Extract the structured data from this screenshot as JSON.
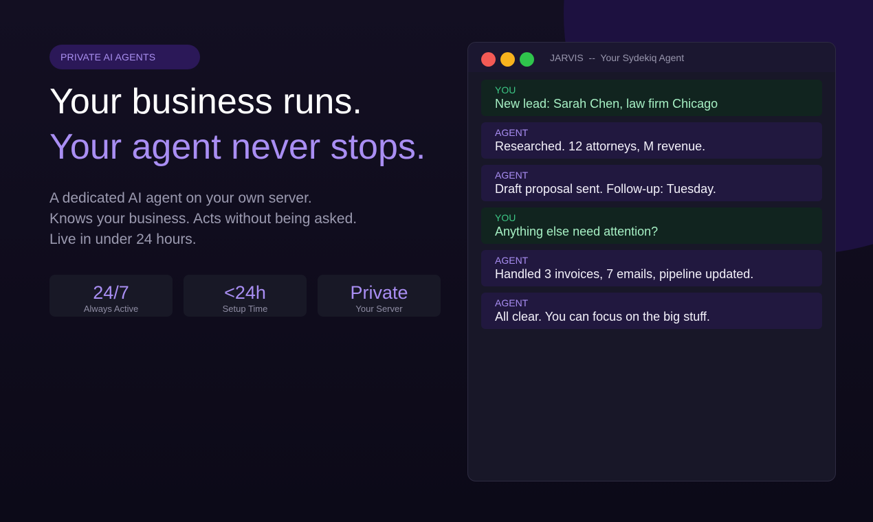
{
  "hero": {
    "badge": "PRIVATE AI AGENTS",
    "headline_line1": "Your business runs.",
    "headline_line2": "Your agent never stops.",
    "description": [
      "A dedicated AI agent on your own server.",
      "Knows your business. Acts without being asked.",
      "Live in under 24 hours."
    ],
    "stats": [
      {
        "value": "24/7",
        "label": "Always Active"
      },
      {
        "value": "<24h",
        "label": "Setup Time"
      },
      {
        "value": "Private",
        "label": "Your Server"
      }
    ]
  },
  "chat_window": {
    "title": "JARVIS  --  Your Sydekiq Agent",
    "messages": [
      {
        "role": "YOU",
        "text": "New lead: Sarah Chen, law firm Chicago"
      },
      {
        "role": "AGENT",
        "text": "Researched. 12 attorneys, M revenue."
      },
      {
        "role": "AGENT",
        "text": "Draft proposal sent. Follow-up: Tuesday."
      },
      {
        "role": "YOU",
        "text": "Anything else need attention?"
      },
      {
        "role": "AGENT",
        "text": "Handled 3 invoices, 7 emails, pipeline updated."
      },
      {
        "role": "AGENT",
        "text": "All clear. You can focus on the big stuff."
      }
    ]
  },
  "colors": {
    "accent": "#a98ef3",
    "background": "#110d1d",
    "you_text": "#a6f0c4",
    "you_role": "#3cc785",
    "close": "#f35a55",
    "minimize": "#f8b31d",
    "maximize": "#2fc44c"
  }
}
